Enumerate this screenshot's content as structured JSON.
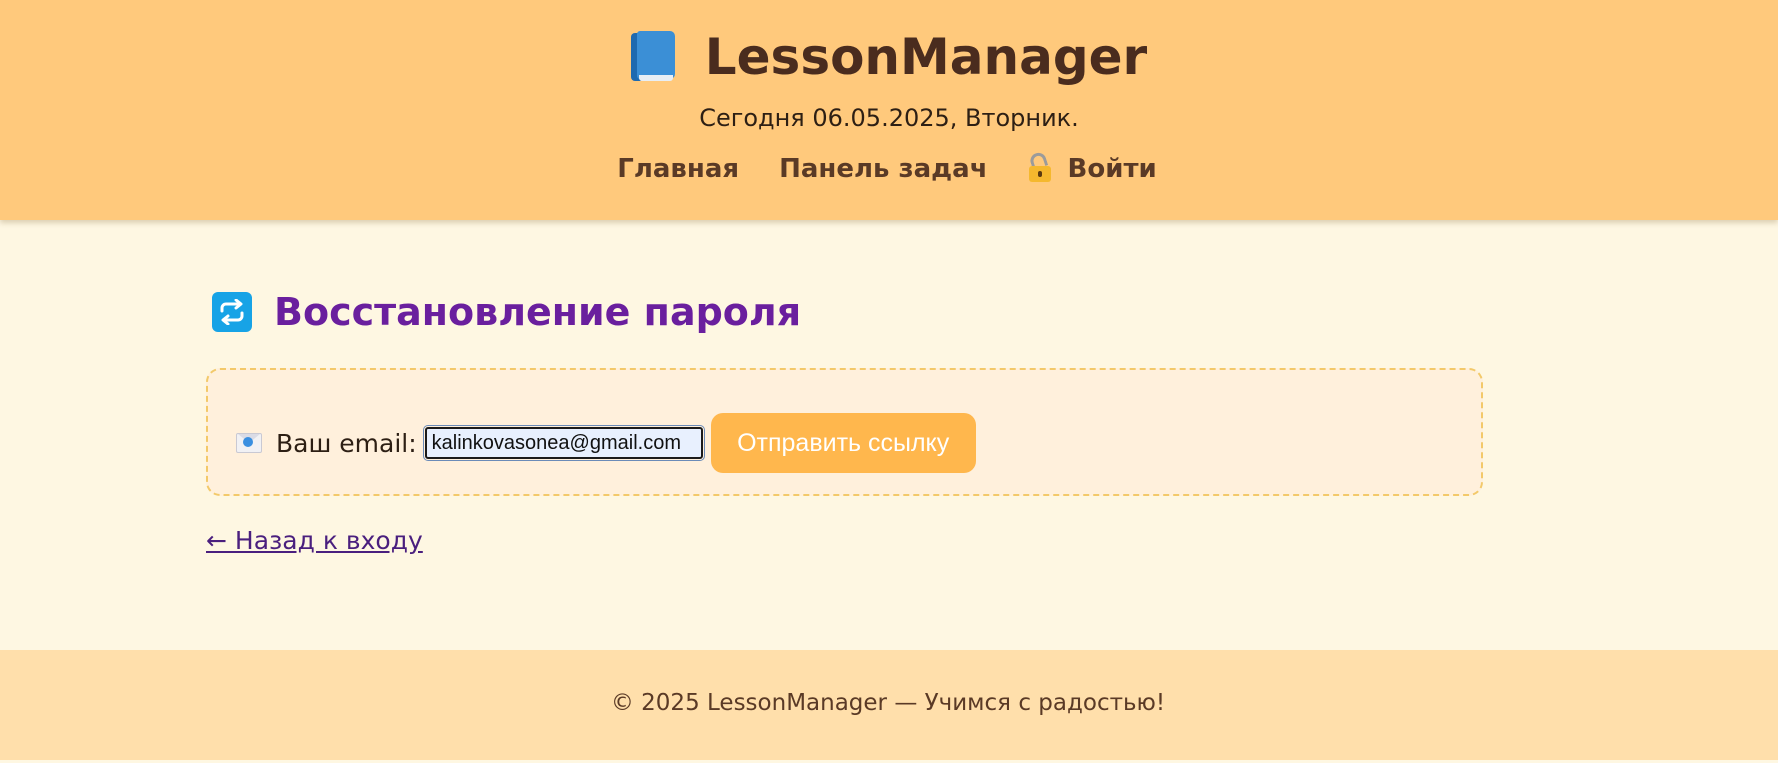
{
  "header": {
    "brand_title": "LessonManager",
    "today_text": "Сегодня 06.05.2025, Вторник.",
    "nav": {
      "home_label": "Главная",
      "tasks_label": "Панель задач",
      "login_label": "Войти"
    }
  },
  "main": {
    "page_title": "Восстановление пароля",
    "form": {
      "email_label": "Ваш email:",
      "email_value": "kalinkovasonea@gmail.com",
      "submit_label": "Отправить ссылку"
    },
    "back_link_label": "← Назад к входу"
  },
  "footer": {
    "text": "© 2025 LessonManager — Учимся с радостью!"
  },
  "icons": {
    "brand": "book-icon",
    "login": "lock-icon",
    "title": "repeat-icon",
    "email": "envelope-icon"
  },
  "colors": {
    "header_bg": "#ffc97c",
    "page_bg": "#fef7e2",
    "title": "#6a1f9e",
    "button": "#ffb74d",
    "footer_bg": "#ffdfab",
    "link": "#4a1f7e"
  }
}
